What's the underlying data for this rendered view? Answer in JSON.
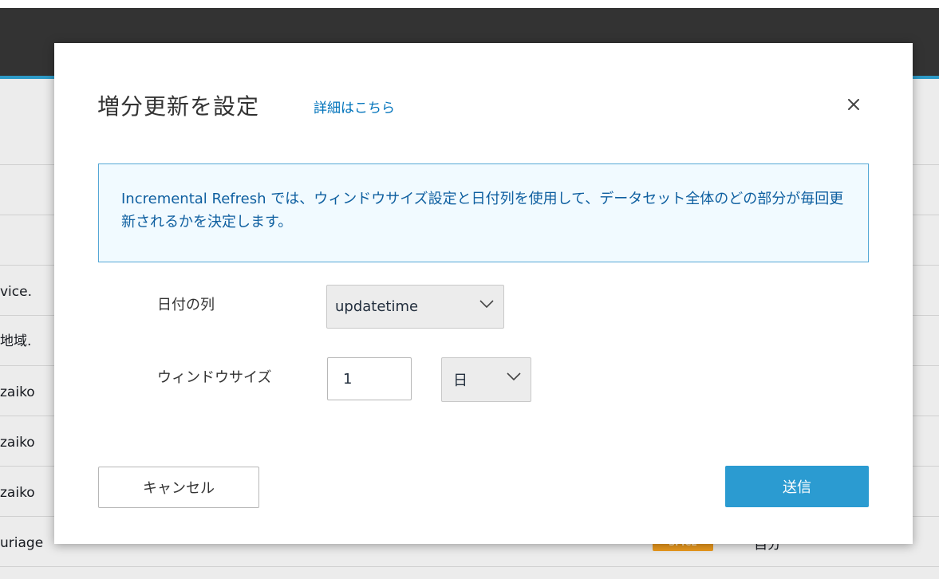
{
  "background": {
    "rows": [
      "vice.",
      "地域.",
      "zaiko",
      "zaiko",
      "zaiko",
      "uriage"
    ],
    "last_row_tag": "SPICE",
    "last_row_mode": "自分"
  },
  "modal": {
    "title": "増分更新を設定",
    "help_link": "詳細はこちら",
    "close_icon": "close-icon",
    "info_text": "Incremental Refresh では、ウィンドウサイズ設定と日付列を使用して、データセット全体のどの部分が毎回更新されるかを決定します。",
    "date_column_label": "日付の列",
    "date_column_value": "updatetime",
    "window_size_label": "ウィンドウサイズ",
    "window_size_value": "1",
    "window_unit_value": "日",
    "cancel_label": "キャンセル",
    "submit_label": "送信"
  },
  "colors": {
    "primary_button": "#2b9bd1",
    "link": "#0073bb",
    "info_text": "#0e5fa0",
    "info_background": "#f1faff",
    "info_border": "#55a7d6",
    "topbar": "#333333",
    "topbar_accent": "#2d9ac7",
    "spice_tag": "#ec9b1e"
  }
}
